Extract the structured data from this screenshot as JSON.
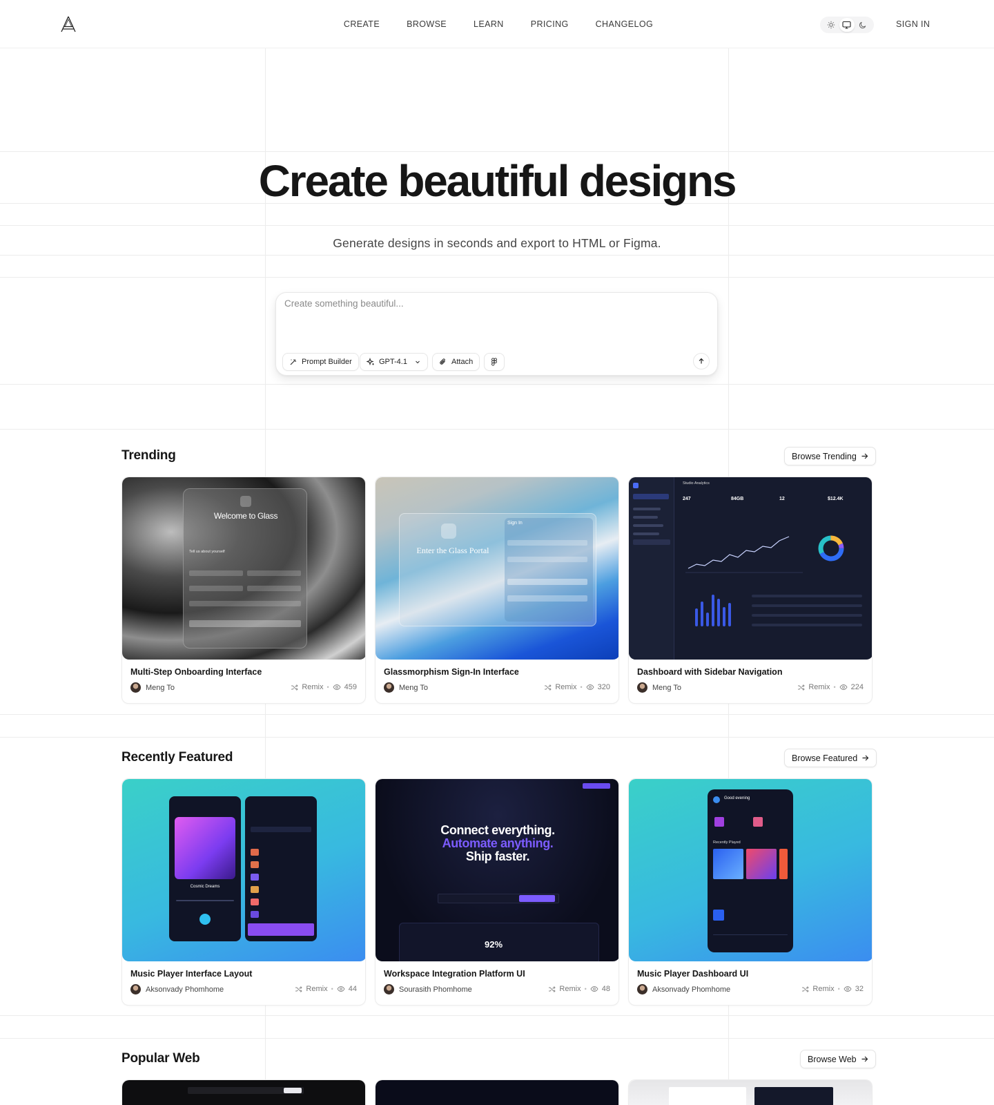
{
  "nav": {
    "items": [
      "CREATE",
      "BROWSE",
      "LEARN",
      "PRICING",
      "CHANGELOG"
    ],
    "sign_in": "SIGN IN"
  },
  "hero": {
    "title": "Create beautiful designs",
    "subtitle": "Generate designs in seconds and export to HTML or Figma."
  },
  "prompt": {
    "placeholder": "Create something beautiful...",
    "prompt_builder": "Prompt Builder",
    "model": "GPT-4.1",
    "attach": "Attach"
  },
  "sections": {
    "trending": {
      "title": "Trending",
      "browse_label": "Browse Trending",
      "cards": [
        {
          "title": "Multi-Step Onboarding Interface",
          "author": "Meng To",
          "remix": "Remix",
          "views": "459",
          "thumb_heading": "Welcome to Glass",
          "thumb_sub": "Tell us about yourself"
        },
        {
          "title": "Glassmorphism Sign-In Interface",
          "author": "Meng To",
          "remix": "Remix",
          "views": "320",
          "thumb_heading": "Enter the Glass Portal",
          "thumb_sub": "Sign In"
        },
        {
          "title": "Dashboard with Sidebar Navigation",
          "author": "Meng To",
          "remix": "Remix",
          "views": "224",
          "thumb_heading": "Studio Analytics",
          "thumb_stats": [
            "247",
            "84GB",
            "12",
            "$12.4K"
          ]
        }
      ]
    },
    "featured": {
      "title": "Recently Featured",
      "browse_label": "Browse Featured",
      "cards": [
        {
          "title": "Music Player Interface Layout",
          "author": "Aksonvady Phomhome",
          "remix": "Remix",
          "views": "44",
          "thumb_heading": "Cosmic Dreams"
        },
        {
          "title": "Workspace Integration Platform UI",
          "author": "Sourasith Phomhome",
          "remix": "Remix",
          "views": "48",
          "thumb_heading": "Connect everything.",
          "thumb_heading2": "Automate anything.",
          "thumb_heading3": "Ship faster.",
          "thumb_stat": "92%"
        },
        {
          "title": "Music Player Dashboard UI",
          "author": "Aksonvady Phomhome",
          "remix": "Remix",
          "views": "32",
          "thumb_heading": "Good evening",
          "thumb_sub": "Recently Played"
        }
      ]
    },
    "popular": {
      "title": "Popular Web",
      "browse_label": "Browse Web"
    }
  },
  "colors": {
    "text_primary": "#161616",
    "grid_line": "#ececec",
    "accent_purple": "#7c5cff",
    "featured_gradient_start": "#3ad0c8",
    "featured_gradient_end": "#3b8df0"
  }
}
